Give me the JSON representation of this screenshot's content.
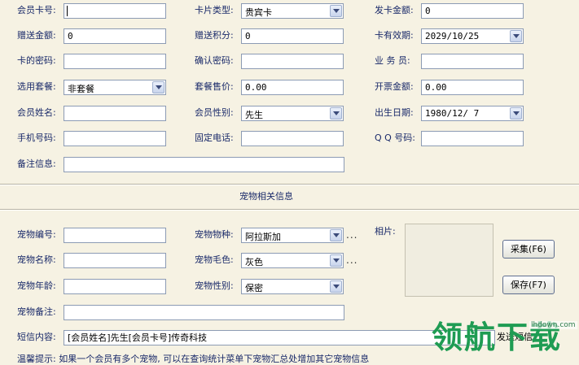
{
  "member": {
    "card_no_label": "会员卡号:",
    "card_no_value": "",
    "card_type_label": "卡片类型:",
    "card_type_value": "贵宾卡",
    "issue_amount_label": "发卡金额:",
    "issue_amount_value": "0",
    "gift_amount_label": "赠送金额:",
    "gift_amount_value": "0",
    "gift_points_label": "赠送积分:",
    "gift_points_value": "0",
    "validity_label": "卡有效期:",
    "validity_value": "2029/10/25",
    "password_label": "卡的密码:",
    "password_value": "",
    "confirm_password_label": "确认密码:",
    "confirm_password_value": "",
    "salesperson_label": "业 务 员:",
    "salesperson_value": "",
    "package_label": "选用套餐:",
    "package_value": "非套餐",
    "package_price_label": "套餐售价:",
    "package_price_value": "0.00",
    "invoice_amount_label": "开票金额:",
    "invoice_amount_value": "0.00",
    "name_label": "会员姓名:",
    "name_value": "",
    "gender_label": "会员性别:",
    "gender_value": "先生",
    "birthday_label": "出生日期:",
    "birthday_value": "1980/12/ 7",
    "mobile_label": "手机号码:",
    "mobile_value": "",
    "phone_label": "固定电话:",
    "phone_value": "",
    "qq_label": "Q Q 号码:",
    "qq_value": "",
    "remark_label": "备注信息:",
    "remark_value": ""
  },
  "pet": {
    "section_title": "宠物相关信息",
    "no_label": "宠物编号:",
    "no_value": "",
    "breed_label": "宠物物种:",
    "breed_value": "阿拉斯加",
    "name_label": "宠物名称:",
    "name_value": "",
    "color_label": "宠物毛色:",
    "color_value": "灰色",
    "age_label": "宠物年龄:",
    "age_value": "",
    "gender_label": "宠物性别:",
    "gender_value": "保密",
    "remark_label": "宠物备注:",
    "remark_value": "",
    "photo_label": "相片:",
    "capture_button": "采集(F6)",
    "save_button": "保存(F7)",
    "more_dots": "..."
  },
  "sms": {
    "label": "短信内容:",
    "value": "[会员姓名]先生[会员卡号]传奇科技",
    "send_label": "发送短信"
  },
  "tip": {
    "text": "温馨提示: 如果一个会员有多个宠物, 可以在查询统计菜单下宠物汇总处增加其它宠物信息"
  },
  "watermark": {
    "text": "领航下载",
    "url": "lhdown.com"
  },
  "colors": {
    "background": "#f6f2e3",
    "label_text": "#1a2a6a",
    "watermark": "#1f9c53"
  }
}
